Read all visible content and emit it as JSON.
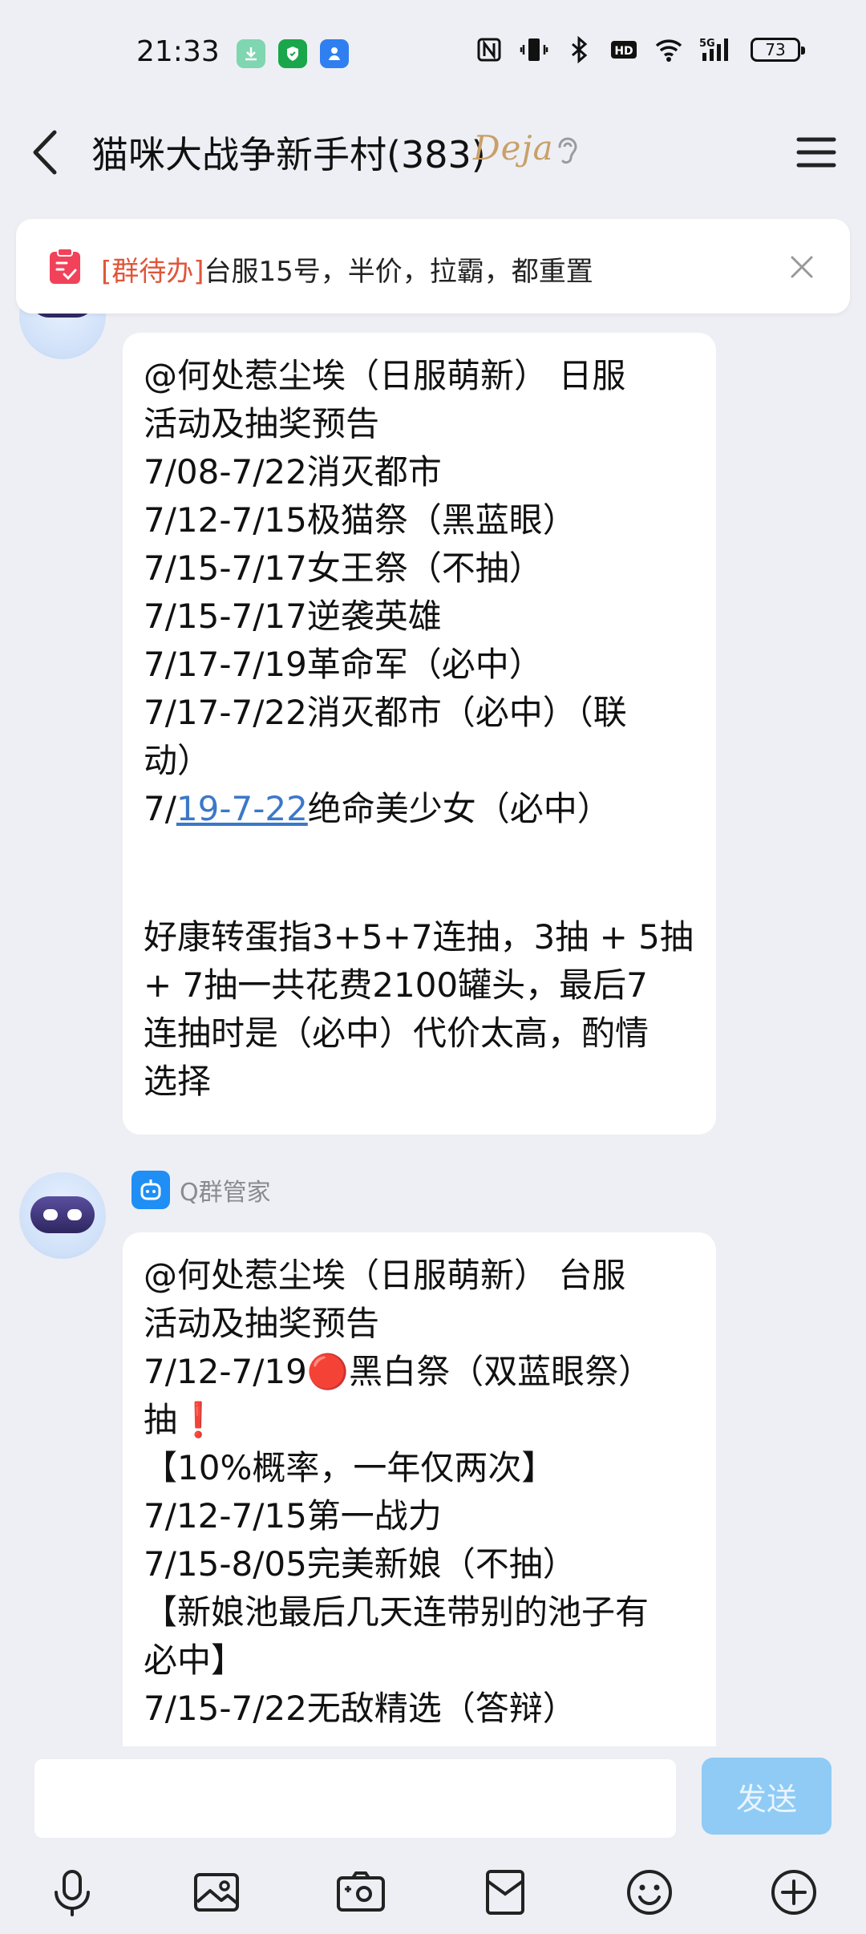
{
  "status_bar": {
    "time": "21:33",
    "battery": "73",
    "icons": [
      "download-icon",
      "shield-icon",
      "person-icon",
      "nfc-icon",
      "vibrate-icon",
      "bluetooth-icon",
      "hd-icon",
      "wifi-icon",
      "signal-5g-icon"
    ]
  },
  "header": {
    "title": "猫咪大战争新手村(383)",
    "badge": "Deja"
  },
  "todo": {
    "tag": "[群待办]",
    "text": "台服15号，半价，拉霸，都重置"
  },
  "messages": [
    {
      "lines": [
        "@何处惹尘埃（日服萌新） 日服",
        "活动及抽奖预告",
        "7/08-7/22消灭都市",
        "7/12-7/15极猫祭（黑蓝眼）",
        "7/15-7/17女王祭（不抽）",
        "7/15-7/17逆袭英雄",
        "7/17-7/19革命军（必中）",
        "7/17-7/22消灭都市（必中）（联",
        "动）"
      ],
      "link_line": {
        "prefix": "7/",
        "link": "19-7-22",
        "suffix": "绝命美少女（必中）"
      },
      "after_lines": [
        "",
        "",
        "好康转蛋指3+5+7连抽，3抽 + 5抽",
        "+ 7抽一共花费2100罐头，最后7",
        "连抽时是（必中）代价太高，酌情",
        "选择"
      ]
    },
    {
      "sender": "Q群管家",
      "lines": [
        "@何处惹尘埃（日服萌新） 台服",
        "活动及抽奖预告",
        "7/12-7/19🔴黑白祭（双蓝眼祭）",
        "抽❗",
        "【10%概率，一年仅两次】",
        "7/12-7/15第一战力",
        "7/15-8/05完美新娘（不抽）",
        "【新娘池最后几天连带别的池子有",
        "必中】",
        "7/15-7/22无敌精选（答辩）"
      ]
    }
  ],
  "input": {
    "placeholder": "",
    "send_label": "发送"
  },
  "toolbar": [
    "microphone-icon",
    "image-icon",
    "camera-icon",
    "red-packet-icon",
    "emoji-icon",
    "plus-icon"
  ]
}
